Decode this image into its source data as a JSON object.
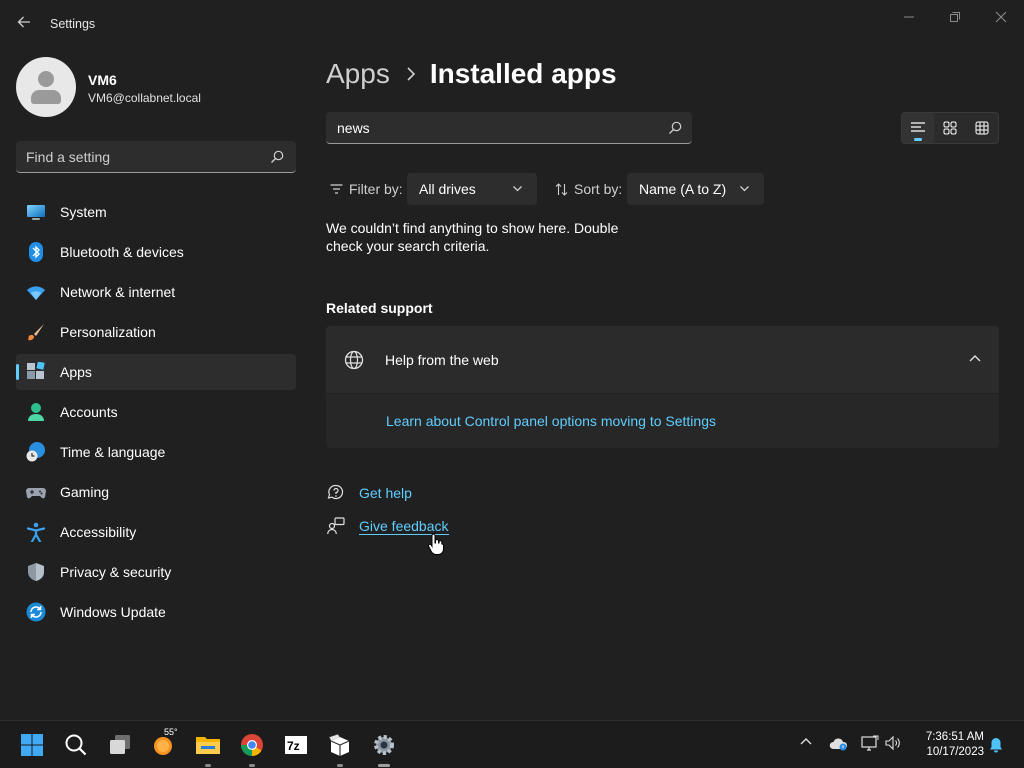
{
  "window": {
    "title": "Settings"
  },
  "profile": {
    "name": "VM6",
    "email": "VM6@collabnet.local"
  },
  "search_settings": {
    "placeholder": "Find a setting"
  },
  "nav": {
    "items": [
      {
        "label": "System"
      },
      {
        "label": "Bluetooth & devices"
      },
      {
        "label": "Network & internet"
      },
      {
        "label": "Personalization"
      },
      {
        "label": "Apps",
        "selected": true
      },
      {
        "label": "Accounts"
      },
      {
        "label": "Time & language"
      },
      {
        "label": "Gaming"
      },
      {
        "label": "Accessibility"
      },
      {
        "label": "Privacy & security"
      },
      {
        "label": "Windows Update"
      }
    ]
  },
  "breadcrumb": {
    "parent": "Apps",
    "current": "Installed apps"
  },
  "app_search": {
    "value": "news"
  },
  "filter": {
    "label": "Filter by:",
    "value": "All drives"
  },
  "sort": {
    "label": "Sort by:",
    "value": "Name (A to Z)"
  },
  "empty_message": "We couldn’t find anything to show here. Double check your search criteria.",
  "related_support": {
    "title": "Related support",
    "card_title": "Help from the web",
    "link": "Learn about Control panel options moving to Settings"
  },
  "footer": {
    "get_help": "Get help",
    "give_feedback": "Give feedback"
  },
  "taskbar": {
    "weather_temp": "55°",
    "time": "7:36:51 AM",
    "date": "10/17/2023"
  },
  "colors": {
    "accent": "#60cdff",
    "background": "#202020",
    "card": "#2b2b2b"
  }
}
